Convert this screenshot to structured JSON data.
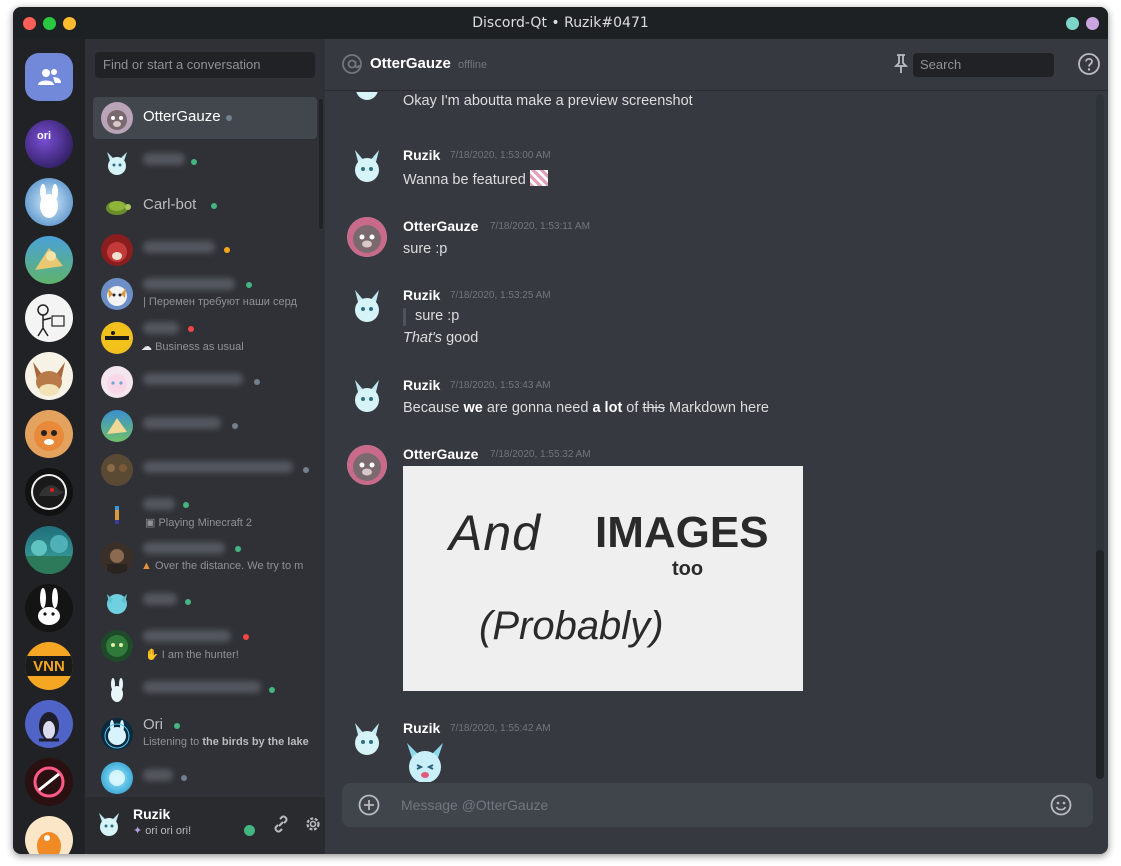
{
  "window": {
    "title": "Discord-Qt • Ruzik#0471",
    "traffic_lights": [
      "#ff5f57",
      "#28c840",
      "#febc2e"
    ],
    "right_dots": [
      "#7ed6c8",
      "#c9a6e0"
    ]
  },
  "guilds": {
    "home_icon": "friends-icon",
    "servers": [
      {
        "name": "ori-server",
        "color": "#3b2a6b",
        "text": "ori"
      },
      {
        "name": "spirit-server",
        "color": "#4a8fc7"
      },
      {
        "name": "griffin-server",
        "color": "#3f8f5a"
      },
      {
        "name": "comic-server",
        "color": "#f2f2f2"
      },
      {
        "name": "eevee-server",
        "color": "#d9a066"
      },
      {
        "name": "fox-server",
        "color": "#d07a3a"
      },
      {
        "name": "crow-server",
        "color": "#111111"
      },
      {
        "name": "forest-server",
        "color": "#2b8f9a"
      },
      {
        "name": "bunny-server",
        "color": "#1c1c1c"
      },
      {
        "name": "vnn-server",
        "color": "#f5a623",
        "text": "VNN"
      },
      {
        "name": "linux-server",
        "color": "#4f63c4"
      },
      {
        "name": "rocket-server",
        "color": "#5b2a2a"
      },
      {
        "name": "bird-server",
        "color": "#f08a24"
      }
    ]
  },
  "sidebar": {
    "search_placeholder": "Find or start a conversation",
    "dms": [
      {
        "name": "OtterGauze",
        "status": "offline",
        "selected": true
      },
      {
        "name": "",
        "status": "online",
        "blurred": true
      },
      {
        "name": "Carl-bot",
        "status": "online"
      },
      {
        "name": "",
        "status": "idle",
        "blurred": true
      },
      {
        "name": "",
        "status": "online",
        "blurred": true,
        "sub": "| Перемен требуют наши серд"
      },
      {
        "name": "",
        "status": "dnd",
        "blurred": true,
        "sub": "Business as usual"
      },
      {
        "name": "",
        "status": "offline",
        "blurred": true
      },
      {
        "name": "",
        "status": "offline",
        "blurred": true
      },
      {
        "name": "",
        "status": "offline",
        "blurred": true
      },
      {
        "name": "",
        "status": "online",
        "blurred": true,
        "sub": "Playing Minecraft 2"
      },
      {
        "name": "",
        "status": "online",
        "blurred": true,
        "sub": "Over the distance. We try to m"
      },
      {
        "name": "",
        "status": "online",
        "blurred": true
      },
      {
        "name": "",
        "status": "dnd",
        "blurred": true,
        "sub": "I am the hunter!"
      },
      {
        "name": "",
        "status": "online",
        "blurred": true
      },
      {
        "name": "Ori",
        "status": "online",
        "sub_prefix": "Listening to ",
        "sub_bold": "the birds by the lake"
      },
      {
        "name": "",
        "status": "offline",
        "blurred": true
      }
    ],
    "status_colors": {
      "online": "#43b581",
      "idle": "#faa61a",
      "dnd": "#f04747",
      "offline": "#747f8d"
    }
  },
  "user_panel": {
    "username": "Ruzik",
    "custom_status": "ori ori ori!",
    "status_color": "#43b581"
  },
  "chat": {
    "recipient": "OtterGauze",
    "recipient_status": "offline",
    "search_placeholder": "Search",
    "messages": [
      {
        "author": "",
        "time": "",
        "lines": [
          "Okay I'm aboutta make a preview screenshot"
        ],
        "continued": true
      },
      {
        "author": "Ruzik",
        "time": "7/18/2020, 1:53:00 AM",
        "lines": [
          "Wanna be featured"
        ]
      },
      {
        "author": "OtterGauze",
        "time": "7/18/2020, 1:53:11 AM",
        "lines": [
          "sure :p"
        ]
      },
      {
        "author": "Ruzik",
        "time": "7/18/2020, 1:53:25 AM",
        "quote": "sure :p",
        "italic": "That's",
        "rest": " good"
      },
      {
        "author": "Ruzik",
        "time": "7/18/2020, 1:53:43 AM",
        "rich": [
          "Because ",
          "we",
          " are gonna need ",
          "a lot",
          " of ",
          "this",
          " Markdown here"
        ]
      },
      {
        "author": "OtterGauze",
        "time": "7/18/2020, 1:55:32 AM",
        "image": {
          "line1": "And",
          "line2": "IMAGES",
          "line3": "too",
          "line4": "(Probably)"
        }
      },
      {
        "author": "Ruzik",
        "time": "7/18/2020, 1:55:42 AM",
        "sticker": true
      }
    ],
    "composer_placeholder": "Message @OtterGauze"
  }
}
